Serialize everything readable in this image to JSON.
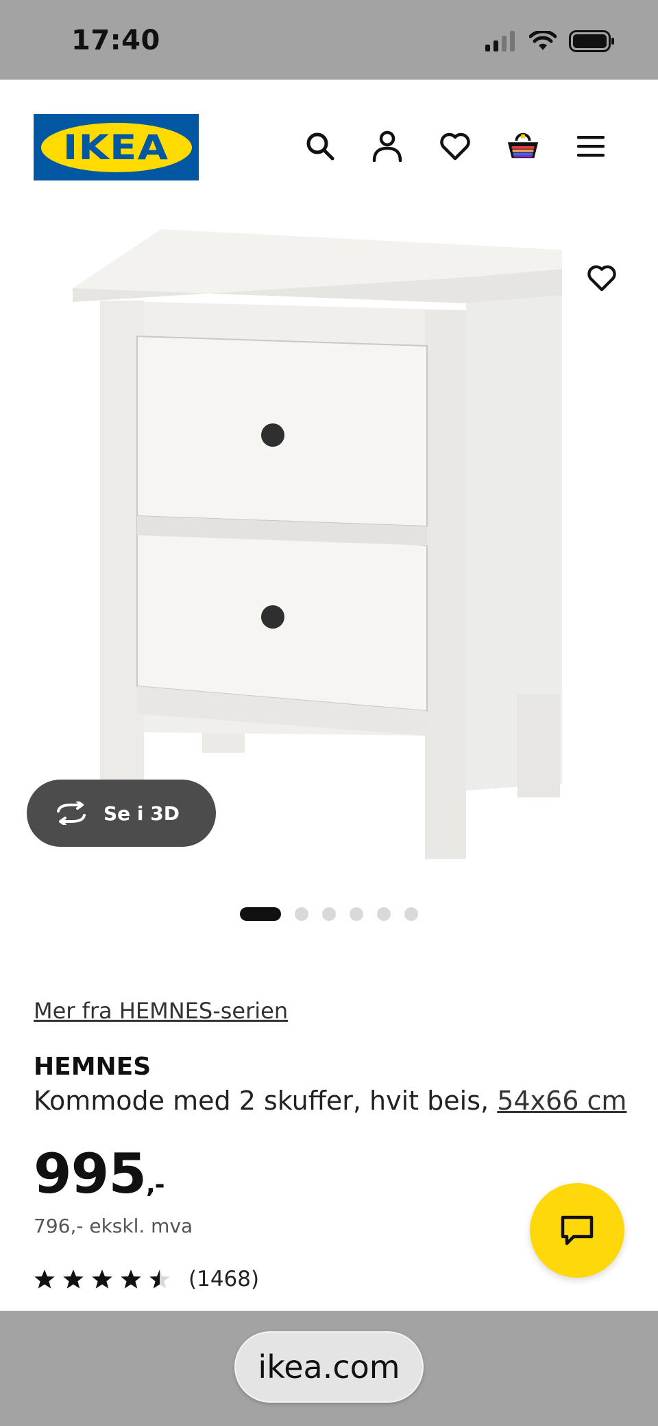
{
  "status_bar": {
    "time": "17:40"
  },
  "header": {
    "logo_text": "IKEA",
    "icons": [
      "search-icon",
      "user-icon",
      "heart-icon",
      "basket-icon",
      "menu-icon"
    ]
  },
  "gallery": {
    "button_3d_label": "Se i 3D",
    "slide_count": 6,
    "active_slide": 1
  },
  "product": {
    "series_link": "Mer fra HEMNES-serien",
    "name": "HEMNES",
    "description": "Kommode med 2 skuffer, hvit beis,",
    "size_link": "54x66 cm",
    "price": "995",
    "price_suffix": ",-",
    "price_ex_vat": "796,- ekskl. mva",
    "rating_stars": 4.5,
    "review_count": "(1468)"
  },
  "browser": {
    "url": "ikea.com"
  },
  "colors": {
    "ikea_blue": "#0058a3",
    "ikea_yellow": "#ffdb00",
    "chat_yellow": "#ffd80c"
  }
}
